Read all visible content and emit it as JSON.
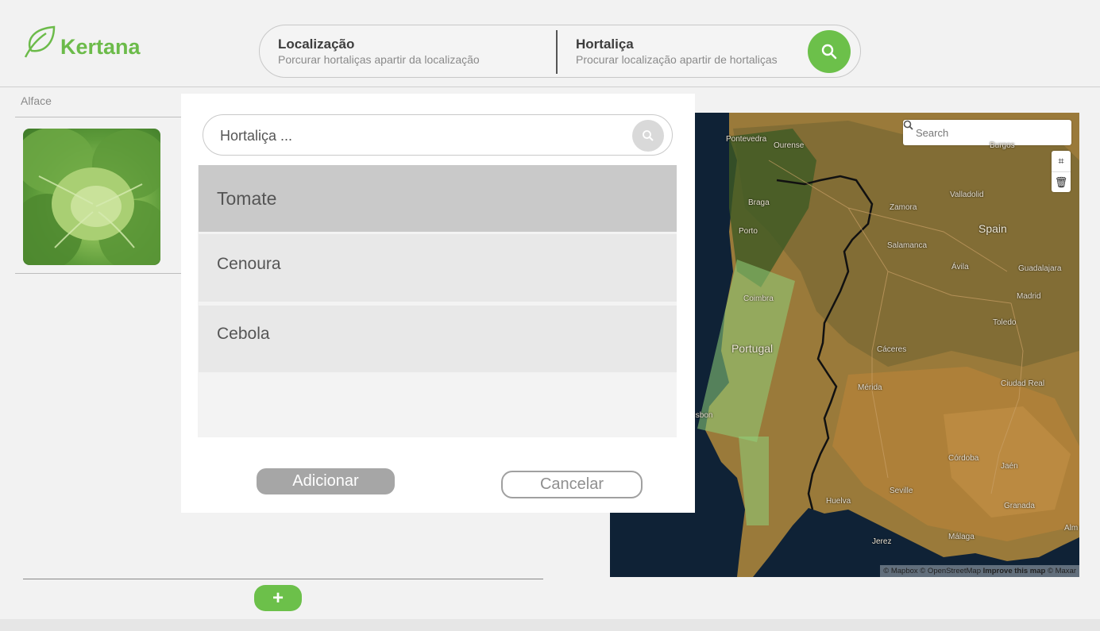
{
  "app": {
    "name": "Kertana",
    "accent_color": "#6cc04a"
  },
  "header": {
    "location": {
      "title": "Localização",
      "subtitle": "Porcurar hortaliças apartir da localização"
    },
    "vegetable": {
      "title": "Hortaliça",
      "subtitle": "Procurar localização apartir de hortaliças"
    },
    "search_icon": "search-icon"
  },
  "left_panel": {
    "breadcrumb": "Alface",
    "image_alt": "lettuce-image"
  },
  "map": {
    "search_placeholder": "Search",
    "labels": {
      "pontevedra": "Pontevedra",
      "ourense": "Ourense",
      "braga": "Braga",
      "porto": "Porto",
      "coimbra": "Coimbra",
      "portugal": "Portugal",
      "lisbon": "Lisbon",
      "burgos": "Burgos",
      "valladolid": "Valladolid",
      "zamora": "Zamora",
      "salamanca": "Salamanca",
      "spain": "Spain",
      "avila": "Ávila",
      "guadalajara": "Guadalajara",
      "madrid": "Madrid",
      "toledo": "Toledo",
      "caceres": "Cáceres",
      "ciudad_real": "Ciudad Real",
      "merida": "Mérida",
      "cordoba": "Córdoba",
      "jaen": "Jaén",
      "huelva": "Huelva",
      "seville": "Seville",
      "granada": "Granada",
      "malaga": "Málaga",
      "jerez": "Jerez",
      "almeria": "Alm"
    },
    "attribution": {
      "text": "© Mapbox © OpenStreetMap",
      "improve": "Improve this map",
      "maxar": "© Maxar"
    }
  },
  "modal": {
    "search_placeholder": "Hortaliça ...",
    "items": [
      {
        "label": "Tomate",
        "selected": true
      },
      {
        "label": "Cenoura",
        "selected": false
      },
      {
        "label": "Cebola",
        "selected": false
      }
    ],
    "add_label": "Adicionar",
    "cancel_label": "Cancelar"
  },
  "footer": {
    "add_button": "+"
  }
}
